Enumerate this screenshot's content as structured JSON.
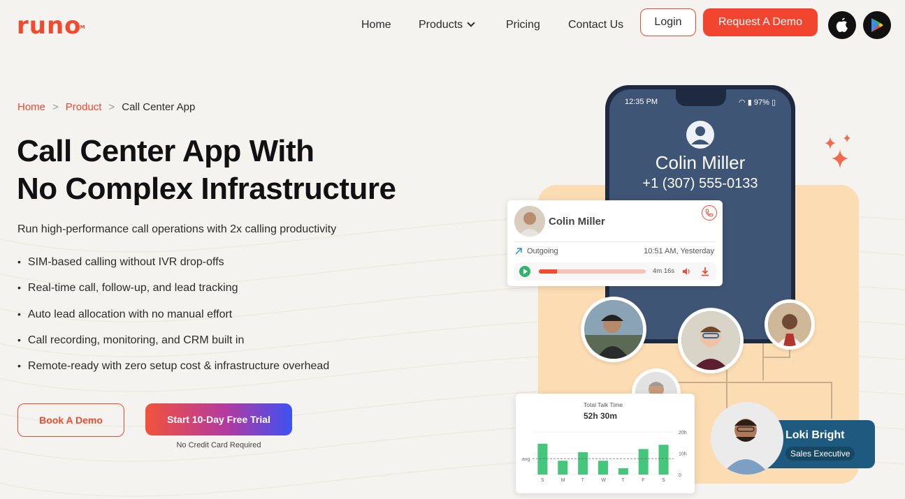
{
  "brand": {
    "logo_text": "runo",
    "accent": "#f04a2f"
  },
  "nav": {
    "items": [
      {
        "label": "Home"
      },
      {
        "label": "Products",
        "has_dropdown": true
      },
      {
        "label": "Pricing"
      },
      {
        "label": "Contact Us"
      }
    ],
    "login_label": "Login",
    "demo_label": "Request A Demo",
    "store_icons": [
      "apple-icon",
      "google-play-icon"
    ]
  },
  "breadcrumb": [
    {
      "label": "Home",
      "link": true
    },
    {
      "label": "Product",
      "link": true
    },
    {
      "label": "Call Center App",
      "link": false
    }
  ],
  "hero": {
    "title_line1": "Call Center App With",
    "title_line2": "No Complex Infrastructure",
    "subtitle": "Run high-performance call operations with 2x calling productivity",
    "bullets": [
      "SIM-based calling without IVR drop-offs",
      "Real-time call, follow-up, and lead tracking",
      "Auto lead allocation with no manual effort",
      "Call recording, monitoring, and CRM built in",
      "Remote-ready with zero setup cost & infrastructure overhead"
    ],
    "book_demo_label": "Book A Demo",
    "trial_label": "Start 10-Day Free Trial",
    "trial_note": "No Credit Card Required"
  },
  "phone": {
    "time": "12:35 PM",
    "battery": "97%",
    "caller_name": "Colin Miller",
    "caller_number": "+1 (307) 555-0133"
  },
  "call_card": {
    "name": "Colin Miller",
    "direction": "Outgoing",
    "when": "10:51 AM, Yesterday",
    "duration": "4m 16s",
    "progress": 0.17
  },
  "talk_time": {
    "label": "Total Talk Time",
    "value": "52h 30m",
    "days": [
      "S",
      "M",
      "T",
      "W",
      "T",
      "F",
      "S"
    ],
    "hours": [
      14.5,
      6.5,
      10.5,
      6.5,
      3,
      12,
      14
    ],
    "y_ticks": [
      "20h",
      "10h",
      "0"
    ],
    "avg_label": "avg",
    "avg_value": 7.5,
    "y_max": 20,
    "bar_color": "#44c77b"
  },
  "rep": {
    "name": "Loki Bright",
    "role": "Sales Executive"
  }
}
